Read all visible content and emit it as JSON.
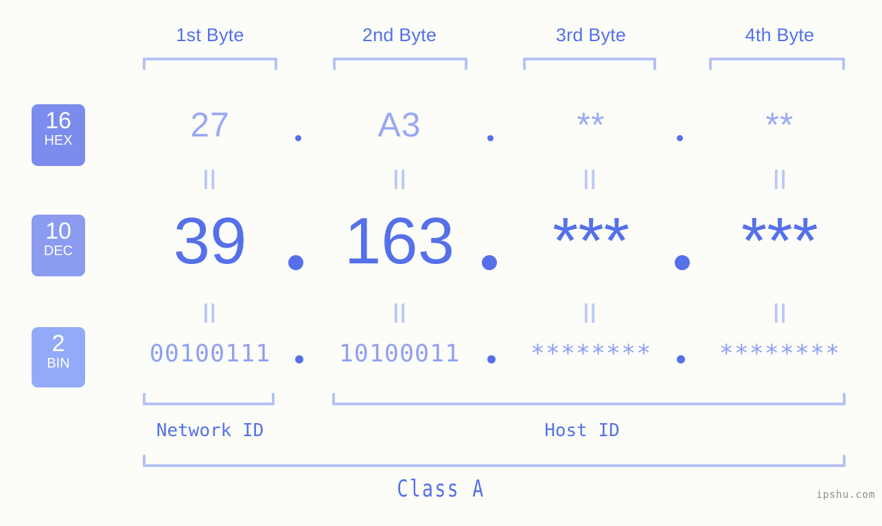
{
  "background_color": "#fcfdf9",
  "accent_color": "#5570e8",
  "accent_light_color": "#b6c1f7",
  "byte_headers": [
    {
      "label": "1st Byte"
    },
    {
      "label": "2nd Byte"
    },
    {
      "label": "3rd Byte"
    },
    {
      "label": "4th Byte"
    }
  ],
  "bases": [
    {
      "number": "16",
      "abbr": "HEX",
      "color": "#7b8ced"
    },
    {
      "number": "10",
      "abbr": "DEC",
      "color": "#8a9bf0"
    },
    {
      "number": "2",
      "abbr": "BIN",
      "color": "#92aaf7"
    }
  ],
  "rows": {
    "hex": {
      "values": [
        "27",
        "A3",
        "**",
        "**"
      ]
    },
    "dec": {
      "values": [
        "39",
        "163",
        "***",
        "***"
      ]
    },
    "bin": {
      "values": [
        "00100111",
        "10100011",
        "********",
        "********"
      ]
    }
  },
  "equals_marks": {
    "hex_to_dec": [
      "||",
      "||",
      "||",
      "||"
    ],
    "dec_to_bin": [
      "||",
      "||",
      "||",
      "||"
    ]
  },
  "separator": ".",
  "id_sections": [
    {
      "label": "Network ID"
    },
    {
      "label": "Host ID"
    }
  ],
  "class_label": "Class A",
  "watermark": "ipshu.com"
}
